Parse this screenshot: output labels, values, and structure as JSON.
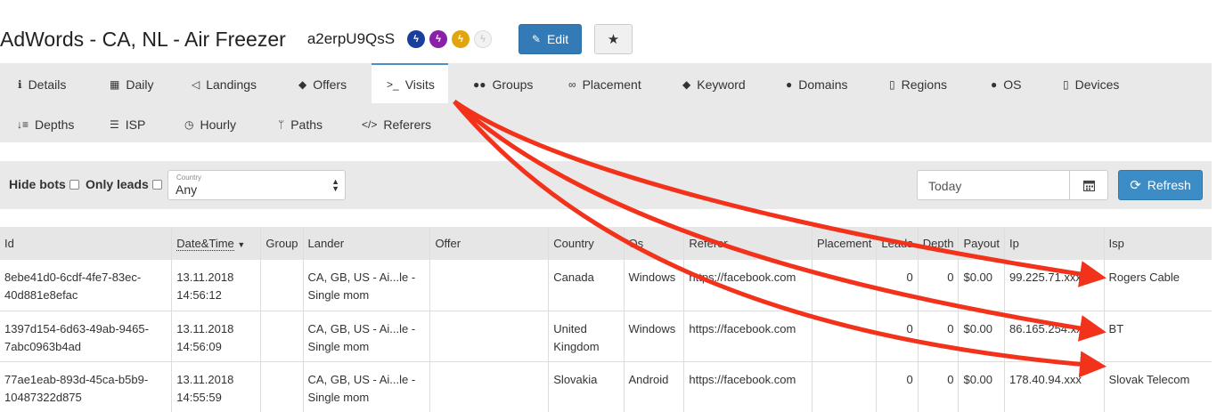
{
  "header": {
    "title": "AdWords - CA, NL - Air Freezer",
    "campaign_id": "a2erpU9QsS",
    "edit_label": "Edit",
    "badge_colors": [
      "#1a3f9b",
      "#8a1fa8",
      "#e2a50e",
      "#e6e6e6"
    ]
  },
  "tabs": [
    {
      "label": "Details",
      "icon": "info-icon"
    },
    {
      "label": "Daily",
      "icon": "calendar-icon"
    },
    {
      "label": "Landings",
      "icon": "paper-plane-icon"
    },
    {
      "label": "Offers",
      "icon": "tag-icon"
    },
    {
      "label": "Visits",
      "icon": "terminal-icon"
    },
    {
      "label": "Groups",
      "icon": "users-icon"
    },
    {
      "label": "Placement",
      "icon": "link-icon"
    },
    {
      "label": "Keyword",
      "icon": "tags-icon"
    },
    {
      "label": "Domains",
      "icon": "globe-icon"
    },
    {
      "label": "Regions",
      "icon": "map-icon"
    },
    {
      "label": "OS",
      "icon": "apple-icon"
    },
    {
      "label": "Devices",
      "icon": "tablet-icon"
    },
    {
      "label": "Depths",
      "icon": "sort-numeric-icon"
    },
    {
      "label": "ISP",
      "icon": "server-icon"
    },
    {
      "label": "Hourly",
      "icon": "clock-icon"
    },
    {
      "label": "Paths",
      "icon": "code-fork-icon"
    },
    {
      "label": "Referers",
      "icon": "code-icon"
    }
  ],
  "active_tab": "Visits",
  "filters": {
    "hide_bots_label": "Hide bots",
    "only_leads_label": "Only leads",
    "country_label": "Country",
    "country_value": "Any",
    "date_value": "Today",
    "refresh_label": "Refresh"
  },
  "table": {
    "columns": [
      "Id",
      "Date&Time",
      "Group",
      "Lander",
      "Offer",
      "Country",
      "Os",
      "Referer",
      "Placement",
      "Leads",
      "Depth",
      "Payout",
      "Ip",
      "Isp"
    ],
    "rows": [
      {
        "id": [
          "8ebe41d0-6cdf-4fe7-83ec-",
          "40d881e8efac"
        ],
        "date": [
          "13.11.2018",
          "14:56:12"
        ],
        "group": "",
        "lander": [
          "CA, GB, US - Ai...le -",
          "Single mom"
        ],
        "offer": "",
        "country": [
          "Canada"
        ],
        "os": "Windows",
        "referer": "https://facebook.com",
        "placement": "",
        "leads": "0",
        "depth": "0",
        "payout": "$0.00",
        "ip": "99.225.71.xxx",
        "isp": "Rogers Cable"
      },
      {
        "id": [
          "1397d154-6d63-49ab-9465-",
          "7abc0963b4ad"
        ],
        "date": [
          "13.11.2018",
          "14:56:09"
        ],
        "group": "",
        "lander": [
          "CA, GB, US - Ai...le -",
          "Single mom"
        ],
        "offer": "",
        "country": [
          "United",
          "Kingdom"
        ],
        "os": "Windows",
        "referer": "https://facebook.com",
        "placement": "",
        "leads": "0",
        "depth": "0",
        "payout": "$0.00",
        "ip": "86.165.254.xxx",
        "isp": "BT"
      },
      {
        "id": [
          "77ae1eab-893d-45ca-b5b9-",
          "10487322d875"
        ],
        "date": [
          "13.11.2018",
          "14:55:59"
        ],
        "group": "",
        "lander": [
          "CA, GB, US - Ai...le -",
          "Single mom"
        ],
        "offer": "",
        "country": [
          "Slovakia"
        ],
        "os": "Android",
        "referer": "https://facebook.com",
        "placement": "",
        "leads": "0",
        "depth": "0",
        "payout": "$0.00",
        "ip": "178.40.94.xxx",
        "isp": "Slovak Telecom"
      }
    ]
  },
  "annotation_color": "#f2321b"
}
